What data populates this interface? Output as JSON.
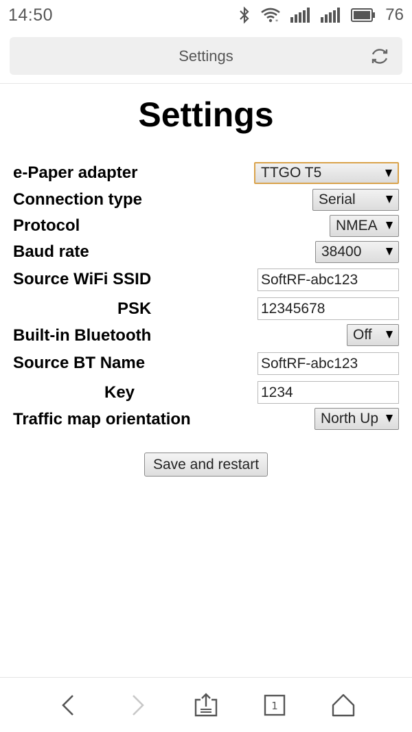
{
  "status_bar": {
    "time": "14:50",
    "battery": "76",
    "icons": [
      "bluetooth-icon",
      "wifi-icon",
      "signal-icon",
      "signal-icon",
      "battery-icon"
    ]
  },
  "browser": {
    "title": "Settings",
    "reload_icon": "reload-icon"
  },
  "page": {
    "heading": "Settings",
    "fields": {
      "epaper_adapter": {
        "label": "e-Paper adapter",
        "value": "TTGO T5"
      },
      "connection_type": {
        "label": "Connection type",
        "value": "Serial"
      },
      "protocol": {
        "label": "Protocol",
        "value": "NMEA"
      },
      "baud_rate": {
        "label": "Baud rate",
        "value": "38400"
      },
      "wifi_ssid": {
        "label": "Source WiFi SSID",
        "value": "SoftRF-abc123"
      },
      "psk": {
        "label": "PSK",
        "value": "12345678"
      },
      "bluetooth": {
        "label": "Built-in Bluetooth",
        "value": "Off"
      },
      "bt_name": {
        "label": "Source BT Name",
        "value": "SoftRF-abc123"
      },
      "key": {
        "label": "Key",
        "value": "1234"
      },
      "orientation": {
        "label": "Traffic map orientation",
        "value": "North Up"
      }
    },
    "save_label": "Save and restart"
  },
  "nav": {
    "tab_count": "1",
    "icons": [
      "back-icon",
      "forward-icon",
      "share-icon",
      "tabs-icon",
      "home-icon"
    ]
  },
  "colors": {
    "focus_border": "#d9a24a",
    "status_text": "#555555"
  }
}
